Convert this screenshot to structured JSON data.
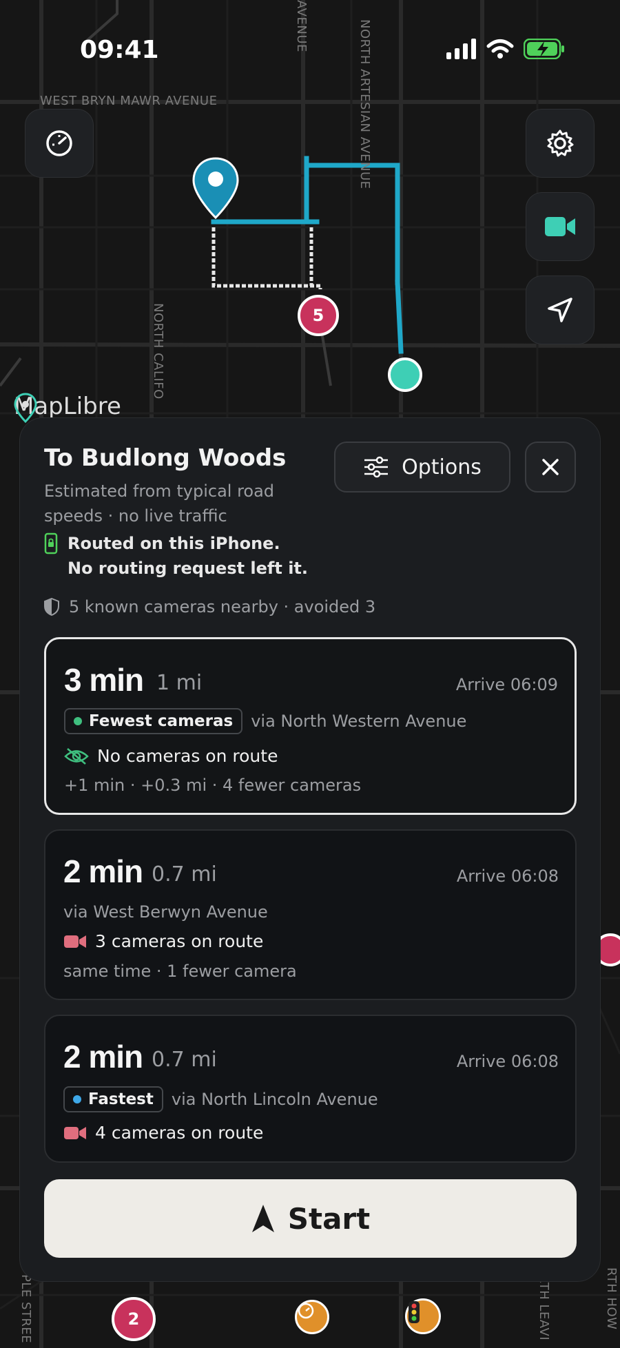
{
  "status_bar": {
    "time": "09:41"
  },
  "map": {
    "streets": {
      "bryn_mawr": "WEST BRYN MAWR AVENUE",
      "avenue_top": "AVENUE",
      "artesian": "NORTH ARTESIAN AVENUE",
      "california": "NORTH CALIFO",
      "maple": "PLE STREE",
      "leavitt": "RTH LEAVI",
      "howard": "RTH HOW"
    },
    "markers": {
      "cluster_top": "5",
      "cluster_bottom": "2"
    },
    "attribution": "MapLibre",
    "colors": {
      "route_blue": "#1fa8c9",
      "route_white": "#ffffff",
      "camera_marker": "#c8325c",
      "destination": "#1a8fb5",
      "current_location": "#3ecfb5"
    },
    "icons": [
      "speedometer-icon",
      "gear-icon",
      "video-camera-icon",
      "navigation-arrow-icon",
      "location-pin-icon"
    ]
  },
  "sheet": {
    "title": "To Budlong Woods",
    "subtitle": "Estimated from typical road speeds · no live traffic",
    "options_label": "Options",
    "privacy_line1": "Routed on this iPhone.",
    "privacy_line2": "No routing request left it.",
    "camera_summary": "5 known cameras nearby · avoided 3",
    "routes": [
      {
        "time": "3 min",
        "distance": "1 mi",
        "arrive": "Arrive 06:09",
        "badge": "Fewest cameras",
        "badge_color": "#3fbf7f",
        "via": "via North Western Avenue",
        "cameras": "No cameras on route",
        "delta": "+1 min · +0.3 mi · 4 fewer cameras",
        "selected": true
      },
      {
        "time": "2 min",
        "distance": "0.7 mi",
        "arrive": "Arrive 06:08",
        "via": "via West Berwyn Avenue",
        "cameras": "3 cameras on route",
        "delta": "same time · 1 fewer camera"
      },
      {
        "time": "2 min",
        "distance": "0.7 mi",
        "arrive": "Arrive 06:08",
        "badge": "Fastest",
        "badge_color": "#3ea8e8",
        "via": "via North Lincoln Avenue",
        "cameras": "4 cameras on route"
      }
    ],
    "start_label": "Start"
  }
}
